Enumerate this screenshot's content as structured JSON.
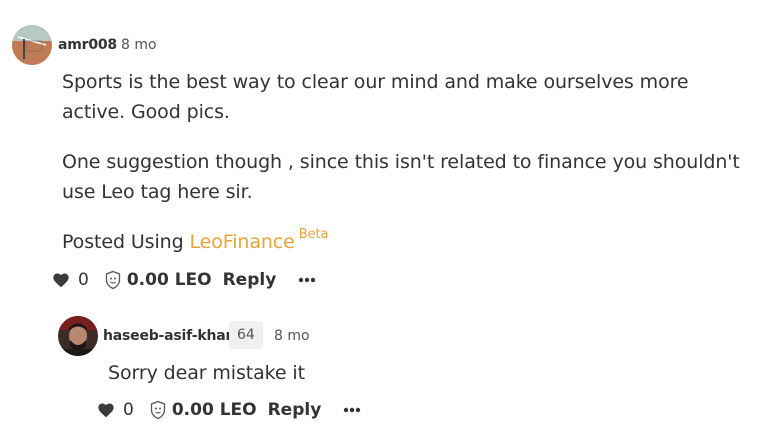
{
  "comment": {
    "author": "amr008",
    "time": "8 mo",
    "paragraph1": "Sports is the best way to clear our mind and make ourselves more active. Good pics.",
    "paragraph2": "One suggestion though , since this isn't related to finance you shouldn't use Leo tag here sir.",
    "posted_prefix": "Posted Using",
    "posted_link": "LeoFinance",
    "posted_badge": "Beta",
    "votes": "0",
    "payout": "0.00 LEO",
    "reply_label": "Reply",
    "more_icon": "ellipsis-icon"
  },
  "reply": {
    "author": "haseeb-asif-khan",
    "reputation": "64",
    "time": "8 mo",
    "text": "Sorry dear mistake it",
    "votes": "0",
    "payout": "0.00 LEO",
    "reply_label": "Reply",
    "more_icon": "ellipsis-icon"
  },
  "colors": {
    "link": "#e8a33c",
    "text": "#333333"
  }
}
